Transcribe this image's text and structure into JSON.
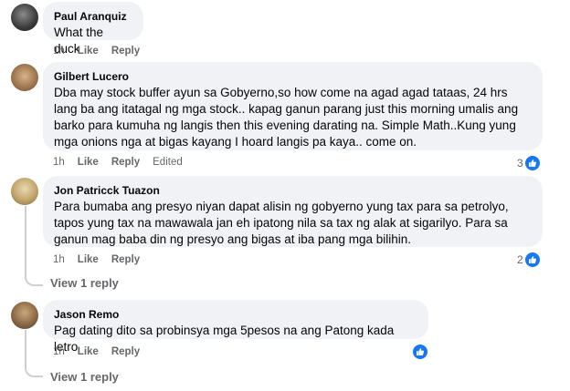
{
  "comments": [
    {
      "name": "Paul Aranquiz",
      "text": "What the duck",
      "time": "1h",
      "like": "Like",
      "reply": "Reply",
      "edited": "",
      "reactions": ""
    },
    {
      "name": "Gilbert Lucero",
      "text": "Dba may stock buffer ayun sa Gobyerno,so how come na agad agad tataas, 24 hrs lang ba ang itatagal ng mga stock.. kapag ganun parang just this morning umalis ang barko para kumuha ng langis then this evening darating na. Simple Math..Kung yung mga onions nga at bigas kayang I hoard langis pa kaya.. come on.",
      "time": "1h",
      "like": "Like",
      "reply": "Reply",
      "edited": "Edited",
      "reactions": "3"
    },
    {
      "name": "Jon Patricck Tuazon",
      "text": "Para bumaba ang presyo niyan dapat alisin ng gobyerno yung tax para sa petrolyo, tapos yung tax na mawawala jan eh ipatong nila sa tax ng alak at sigarilyo. Para sa ganun mag baba din ng presyo ang bigas at iba pang mga bilihin.",
      "time": "1h",
      "like": "Like",
      "reply": "Reply",
      "edited": "",
      "reactions": "2",
      "view_replies": "View 1 reply"
    },
    {
      "name": "Jason Remo",
      "text": "Pag dating dito sa probinsya mga 5pesos na ang Patong kada letro",
      "time": "1h",
      "like": "Like",
      "reply": "Reply",
      "edited": "",
      "reactions": "",
      "view_replies": "View 1 reply"
    }
  ],
  "colors": {
    "bubble": "#f0f2f5",
    "meta": "#65676b",
    "like_blue": "#1877f2"
  },
  "icons": {
    "reaction": "like-thumb-icon"
  }
}
